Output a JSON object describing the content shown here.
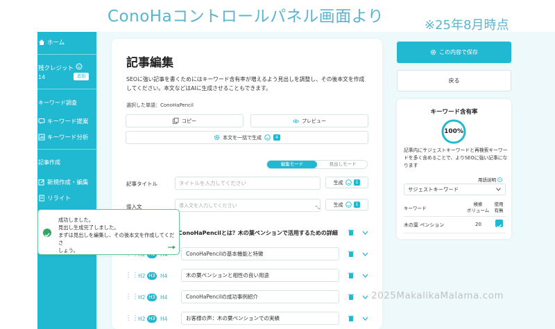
{
  "overlay": {
    "caption": "ConoHaコントロールパネル画面より",
    "date_note": "※25年8月時点",
    "watermark": "2025MakalikaMalama.com"
  },
  "sidebar": {
    "home": "ホーム",
    "credit_label": "残クレジット",
    "credit_value": "14",
    "add_button": "追加",
    "section_keyword": "キーワード調査",
    "keyword_suggest": "キーワード提案",
    "keyword_analysis": "キーワード分析",
    "section_article": "記事作成",
    "new_article": "新規作成・編集",
    "rewrite": "リライト"
  },
  "editor": {
    "title": "記事編集",
    "description": "SEOに強い記事を書くためにはキーワード含有率が増えるよう見出しを調整し、その後本文を作成してください。本文などはAIに生成させることもできます。",
    "selected_word": "選択した単語：ConoHaPencil",
    "copy_button": "コピー",
    "preview_button": "プレビュー",
    "bulk_generate_button": "本文を一括で生成",
    "bulk_generate_count": "4",
    "mode_edit": "編集モード",
    "mode_heading": "見出しモード",
    "article_title_label": "記事タイトル",
    "article_title_placeholder": "タイトルを入力してください",
    "intro_label": "導入文",
    "intro_placeholder": "導入文を入力してください",
    "generate_label": "生成",
    "generate_count": "1",
    "h2_title": "ConoHaPencilとは？木の葉ペンションで活用するための詳細",
    "headings": [
      {
        "h2": "H2",
        "h3": "H3",
        "h4": "H4",
        "text": "ConoHaPencilの基本機能と特徴"
      },
      {
        "h2": "H2",
        "h3": "H3",
        "h4": "H4",
        "text": "木の葉ペンションと相性の良い用途"
      },
      {
        "h2": "H2",
        "h3": "H3",
        "h4": "H4",
        "text": "ConoHaPencilの成功事例紹介"
      },
      {
        "h2": "H2",
        "h3": "H3",
        "h4": "H4",
        "text": "お客様の声：木の葉ペンションでの実績"
      }
    ]
  },
  "toast": {
    "line1": "成功しました。",
    "line2": "見出し生成完了しました。",
    "line3": "まずは見出しを編集し、その後本文を作成してくださ",
    "line4": "しょう。"
  },
  "right_panel": {
    "save_button": "この内容で保存",
    "back_button": "戻る",
    "kw_title": "キーワード含有率",
    "rate": "100%",
    "kw_description": "記事内にサジェストキーワードと再検索キーワードを多く含めることで、よりSEOに強い記事になります",
    "term_link": "用語説明",
    "select_value": "サジェストキーワード",
    "col_keyword": "キーワード",
    "col_volume_1": "検索",
    "col_volume_2": "ボリューム",
    "col_use_1": "使用",
    "col_use_2": "有無",
    "rows": [
      {
        "keyword": "木の葉 ペンション",
        "volume": "20",
        "used": true
      }
    ]
  },
  "colors": {
    "accent": "#21b8d2",
    "success": "#35a464",
    "caption": "#5ab4cf"
  }
}
